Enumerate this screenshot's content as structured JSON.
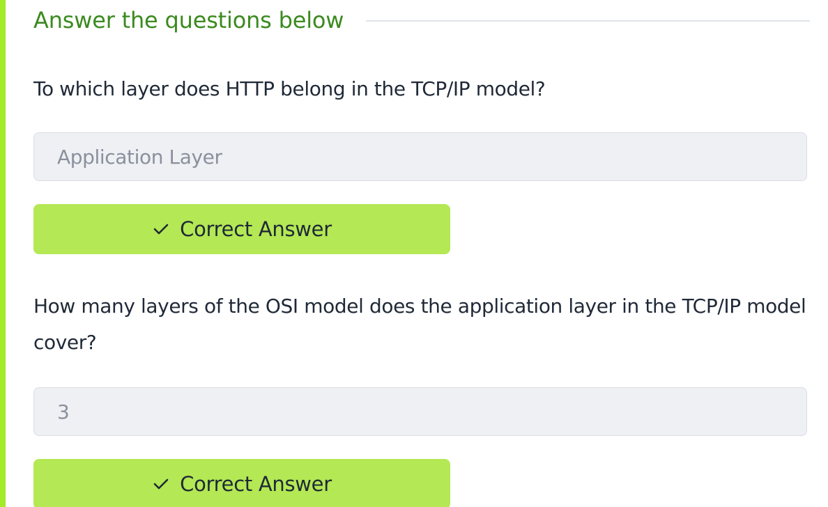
{
  "section": {
    "title": "Answer the questions below"
  },
  "questions": [
    {
      "text": "To which layer does HTTP belong in the TCP/IP model?",
      "answer": "Application Layer",
      "button_label": "Correct Answer"
    },
    {
      "text": "How many layers of the OSI model does the application layer in the TCP/IP model cover?",
      "answer": "3",
      "button_label": "Correct Answer"
    }
  ],
  "icons": {
    "check": "check-icon"
  },
  "colors": {
    "accent": "#a3ea2a",
    "title": "#3b8a1f",
    "button": "#b4e854",
    "input_bg": "#eef0f4"
  }
}
